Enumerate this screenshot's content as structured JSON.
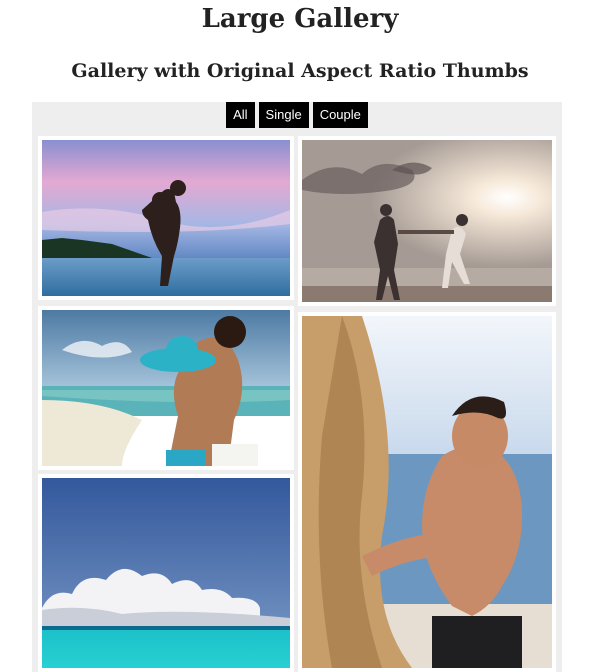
{
  "header": {
    "title": "Large Gallery",
    "subtitle": "Gallery with Original Aspect Ratio Thumbs"
  },
  "filters": [
    "All",
    "Single",
    "Couple"
  ],
  "colors": {
    "button_bg": "#000000",
    "button_text": "#ffffff",
    "gallery_bg": "#eeeeee"
  },
  "thumbnails": [
    {
      "name": "sunset-couple-hug"
    },
    {
      "name": "beach-couple-dancing"
    },
    {
      "name": "couple-hat-embrace"
    },
    {
      "name": "man-reaching-hand"
    },
    {
      "name": "sea-clouds-horizon"
    }
  ]
}
